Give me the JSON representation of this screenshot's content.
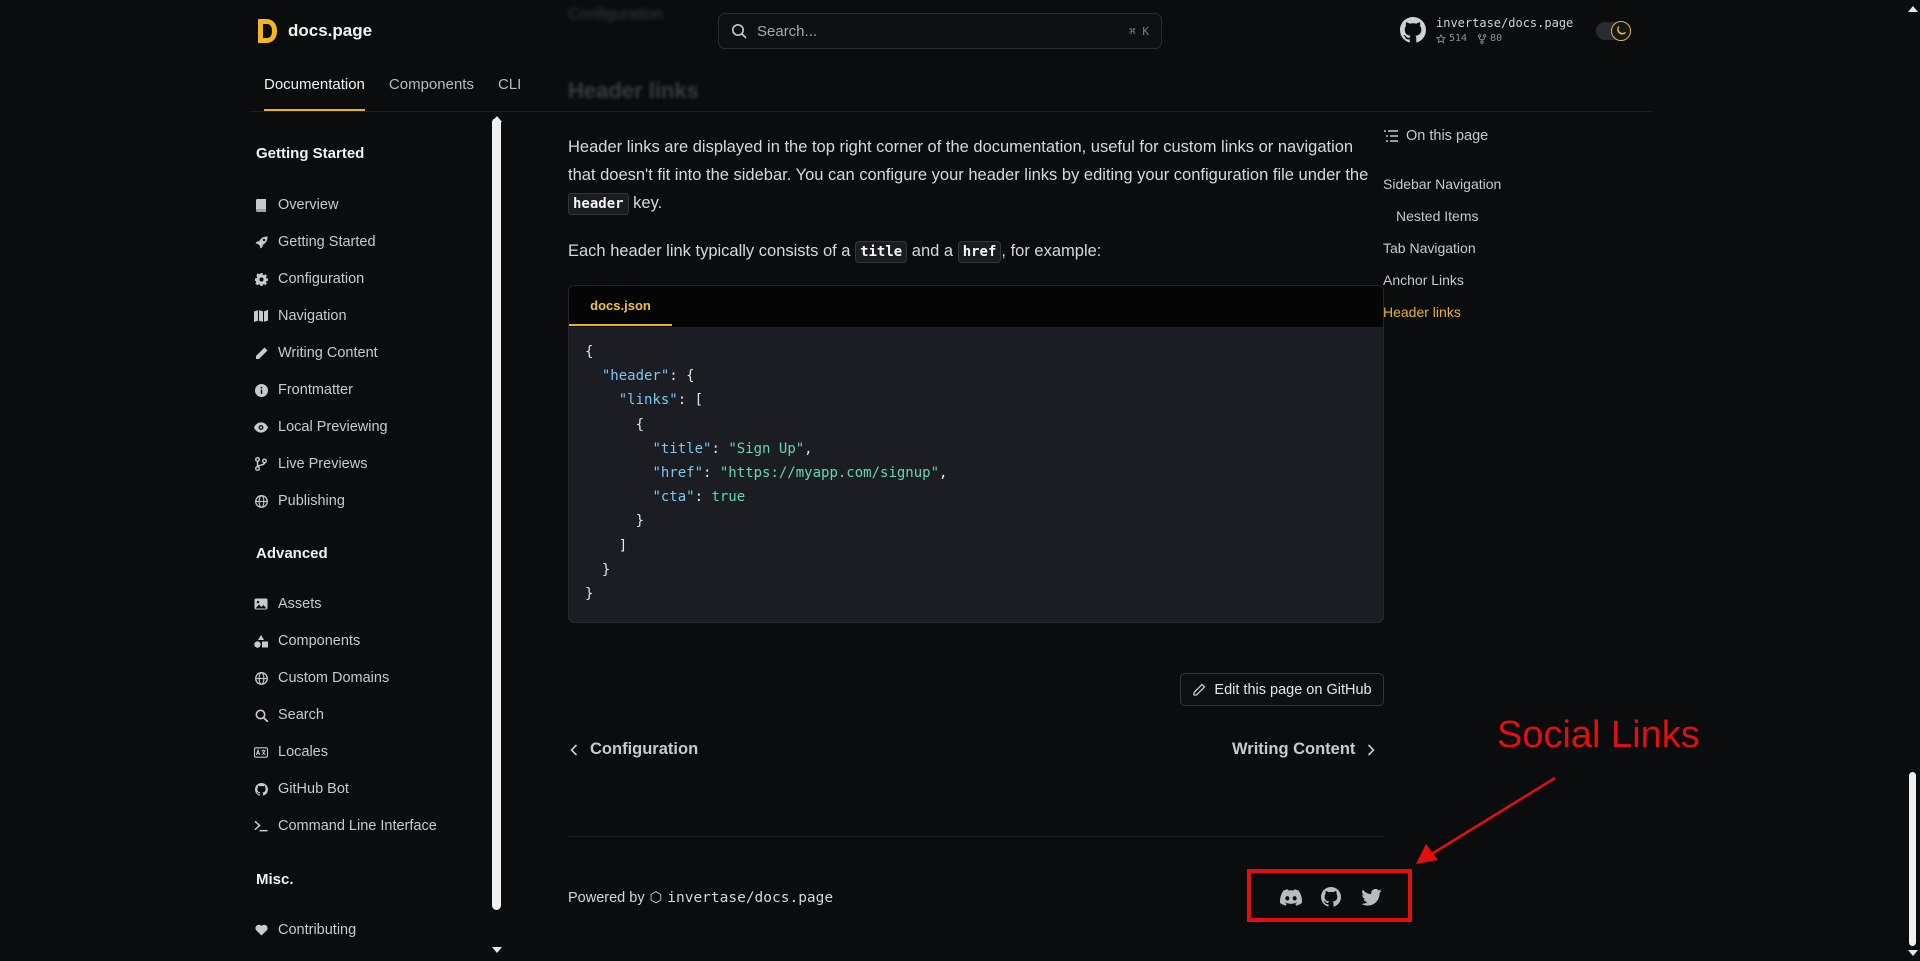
{
  "header": {
    "brand": "docs.page",
    "search_placeholder": "Search...",
    "search_shortcut": "⌘ K",
    "repo_name": "invertase/docs.page",
    "repo_stars": "514",
    "repo_forks": "80"
  },
  "tabs": [
    {
      "label": "Documentation",
      "active": true
    },
    {
      "label": "Components"
    },
    {
      "label": "CLI"
    }
  ],
  "sidebar": {
    "sections": [
      {
        "title": "Getting Started"
      },
      {
        "title": "Advanced"
      },
      {
        "title": "Misc."
      }
    ],
    "items": [
      {
        "label": "Overview",
        "icon": "book-icon"
      },
      {
        "label": "Getting Started",
        "icon": "rocket-icon"
      },
      {
        "label": "Configuration",
        "icon": "gear-icon"
      },
      {
        "label": "Navigation",
        "icon": "map-icon"
      },
      {
        "label": "Writing Content",
        "icon": "pencil-icon"
      },
      {
        "label": "Frontmatter",
        "icon": "info-icon"
      },
      {
        "label": "Local Previewing",
        "icon": "eye-icon"
      },
      {
        "label": "Live Previews",
        "icon": "branch-icon"
      },
      {
        "label": "Publishing",
        "icon": "globe-icon"
      },
      {
        "label": "Assets",
        "icon": "image-icon"
      },
      {
        "label": "Components",
        "icon": "shapes-icon"
      },
      {
        "label": "Custom Domains",
        "icon": "globe-icon"
      },
      {
        "label": "Search",
        "icon": "search-icon"
      },
      {
        "label": "Locales",
        "icon": "language-icon"
      },
      {
        "label": "GitHub Bot",
        "icon": "github-icon"
      },
      {
        "label": "Command Line Interface",
        "icon": "terminal-icon"
      },
      {
        "label": "Contributing",
        "icon": "heart-icon"
      }
    ]
  },
  "content": {
    "blurred_top": "Configuration",
    "heading": "Header links",
    "para1_a": "Header links are displayed in the top right corner of the documentation, useful for custom links or navigation that doesn't fit into the sidebar. You can configure your header links by editing your configuration file under the ",
    "para1_code": "header",
    "para1_b": " key.",
    "para2_a": "Each header link typically consists of a ",
    "para2_code1": "title",
    "para2_mid": " and a ",
    "para2_code2": "href",
    "para2_b": ", for example:",
    "code_tab": "docs.json",
    "code": {
      "l1": "{",
      "l2_key": "\"header\"",
      "l2_rest": ": {",
      "l3_key": "\"links\"",
      "l3_rest": ": [",
      "l4": "{",
      "l5_key": "\"title\"",
      "l5_sep": ": ",
      "l5_val": "\"Sign Up\"",
      "l5_end": ",",
      "l6_key": "\"href\"",
      "l6_sep": ": ",
      "l6_val": "\"https://myapp.com/signup\"",
      "l6_end": ",",
      "l7_key": "\"cta\"",
      "l7_sep": ": ",
      "l7_val": "true",
      "l8": "}",
      "l9": "]",
      "l10": "}",
      "l11": "}"
    },
    "edit_label": "Edit this page on GitHub",
    "prev_label": "Configuration",
    "next_label": "Writing Content",
    "powered_by": "Powered by",
    "powered_logo": "⬡",
    "powered_repo": "invertase/docs.page"
  },
  "toc": {
    "title": "On this page",
    "items": [
      {
        "label": "Sidebar Navigation"
      },
      {
        "label": "Nested Items"
      },
      {
        "label": "Tab Navigation"
      },
      {
        "label": "Anchor Links"
      },
      {
        "label": "Header links",
        "active": true
      }
    ]
  },
  "social": {
    "icons": [
      "discord-icon",
      "github-icon",
      "twitter-icon"
    ]
  },
  "annotation": {
    "label": "Social Links",
    "color": "#e01010"
  },
  "colors": {
    "accent": "#e6b422",
    "background": "#0b0c0e"
  }
}
